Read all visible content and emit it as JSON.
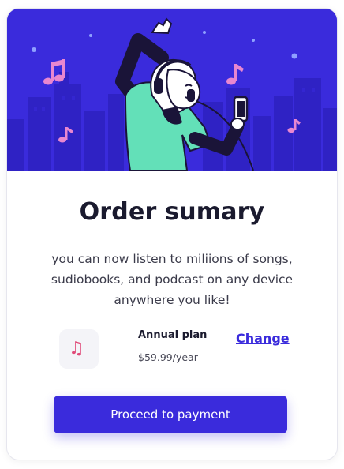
{
  "card": {
    "title": "Order sumary",
    "description": "you can now listen to miliions of songs, sudiobooks, and podcast on any device anywhere you like!"
  },
  "hero": {
    "illustration": "woman-listening-to-music-with-headphones",
    "icons": [
      "music-note-icon",
      "music-note-icon",
      "music-note-icon",
      "music-note-icon"
    ]
  },
  "plan": {
    "icon": "music-note-icon",
    "name": "Annual plan",
    "price": "$59.99/year",
    "change_label": "Change"
  },
  "actions": {
    "proceed_label": "Proceed to payment"
  },
  "colors": {
    "accent": "#3a2bdc",
    "hero_bg": "#3a2bdc",
    "skyline": "#2f22c4",
    "shirt": "#63e0b8",
    "note_pink": "#e887d0",
    "title_text": "#1a1a2e"
  }
}
